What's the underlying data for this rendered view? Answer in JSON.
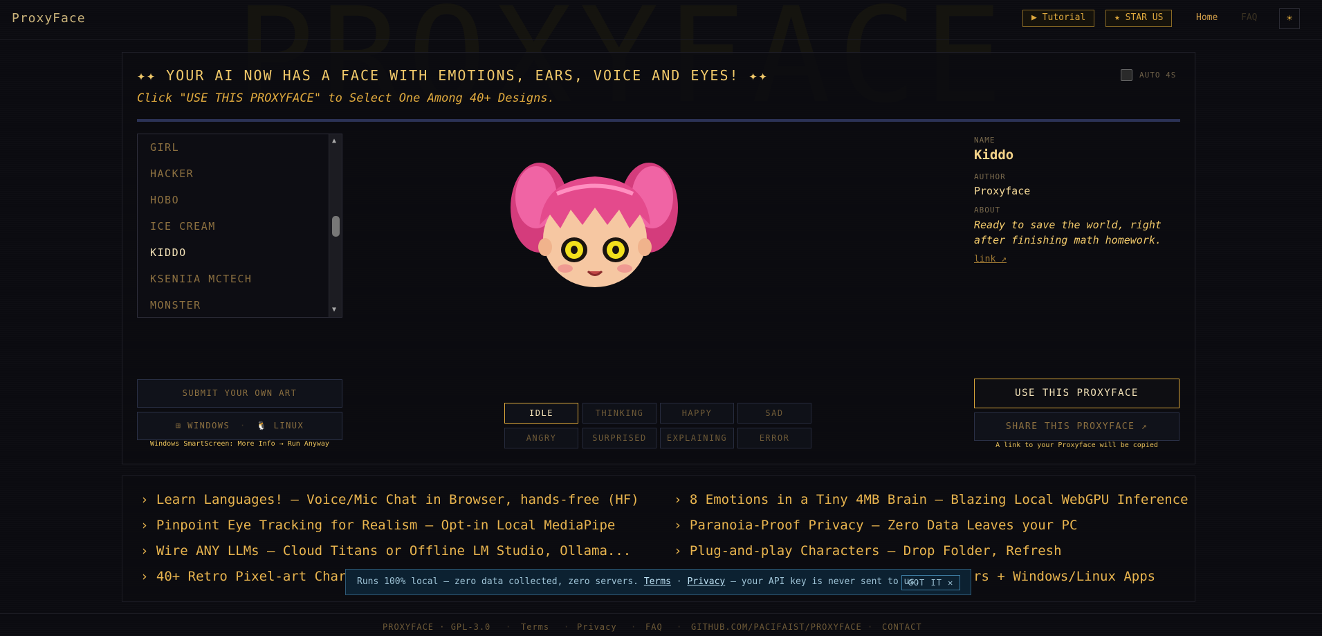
{
  "bg_word": "PROXYFACE",
  "app": {
    "brand": "ProxyFace"
  },
  "nav": {
    "tutorial": "▶ Tutorial",
    "star": "★ STAR US",
    "home": "Home",
    "faq": "FAQ",
    "theme_icon": "☀"
  },
  "hero": {
    "headline": "✦✦ YOUR AI NOW HAS A FACE WITH EMOTIONS, EARS, VOICE AND EYES! ✦✦",
    "subhead": "Click \"USE THIS PROXYFACE\" to Select One Among 40+ Designs.",
    "auto_label": "AUTO 4S",
    "auto_checked": false
  },
  "characters": {
    "items": [
      "GIRL",
      "HACKER",
      "HOBO",
      "ICE CREAM",
      "KIDDO",
      "KSENIIA MCTECH",
      "MONSTER"
    ],
    "selected": "KIDDO"
  },
  "meta": {
    "name_label": "NAME",
    "name": "Kiddo",
    "author_label": "AUTHOR",
    "author": "Proxyface",
    "about_label": "ABOUT",
    "about": "Ready to save the world, right after finishing math homework.",
    "link": "link ↗"
  },
  "actions": {
    "submit": "SUBMIT YOUR OWN ART",
    "windows": "⊞ WINDOWS",
    "sep": "·",
    "linux": "🐧 LINUX",
    "windows_note": "Windows SmartScreen: More Info → Run Anyway",
    "use": "USE THIS PROXYFACE",
    "share": "SHARE THIS PROXYFACE ↗",
    "share_note": "A link to your Proxyface will be copied"
  },
  "emotions": {
    "items": [
      "IDLE",
      "THINKING",
      "HAPPY",
      "SAD",
      "ANGRY",
      "SURPRISED",
      "EXPLAINING",
      "ERROR"
    ],
    "active": "IDLE"
  },
  "features": [
    "› Learn Languages! — Voice/Mic Chat in Browser, hands-free (HF)",
    "› 8 Emotions in a Tiny 4MB Brain — Blazing Local WebGPU Inference",
    "› Pinpoint Eye Tracking for Realism — Opt-in Local MediaPipe",
    "› Paranoia-Proof Privacy — Zero Data Leaves your PC",
    "› Wire ANY LLMs — Cloud Titans or Offline LM Studio, Ollama...",
    "› Plug-and-play Characters — Drop Folder, Refresh",
    "› 40+ Retro Pixel-art Chara",
    "rs + Windows/Linux Apps"
  ],
  "banner": {
    "text_a": "Runs 100% local — zero data collected, zero servers.",
    "terms": "Terms",
    "mid": "·",
    "privacy": "Privacy",
    "text_b": "— your API key is never sent to us.",
    "got_it": "GOT IT ✕"
  },
  "footer": {
    "brand": "PROXYFACE · GPL-3.0",
    "terms": "Terms",
    "privacy": "Privacy",
    "faq": "FAQ",
    "github": "GITHUB.COM/PACIFAIST/PROXYFACE",
    "contact": "CONTACT",
    "sep": "·"
  },
  "colors": {
    "accent": "#d9a63b",
    "background": "#0b0b10",
    "banner_bg": "#0c2131",
    "hair": "#e0468a",
    "eyes": "#f2e01c"
  }
}
